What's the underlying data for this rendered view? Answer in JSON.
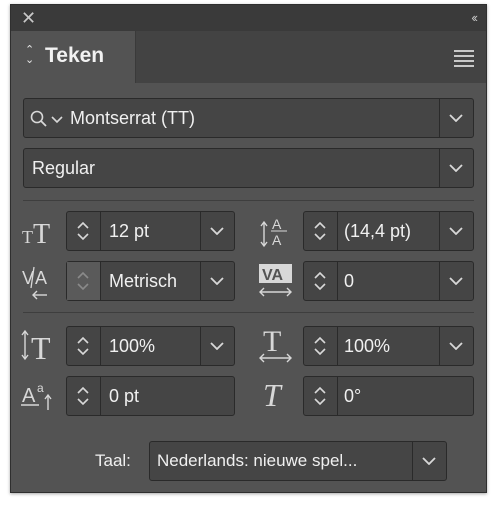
{
  "panel": {
    "close_icon": "close-icon",
    "collapse_glyph": "‹‹",
    "tab_label": "Teken",
    "menu_icon": "hamburger-menu-icon"
  },
  "font": {
    "family": "Montserrat (TT)",
    "style": "Regular"
  },
  "controls": {
    "font_size": "12 pt",
    "leading": "(14,4 pt)",
    "kerning": "Metrisch",
    "tracking": "0",
    "vertical_scale": "100%",
    "horizontal_scale": "100%",
    "baseline_shift": "0 pt",
    "skew": "0°"
  },
  "language": {
    "label": "Taal:",
    "value": "Nederlands: nieuwe spel..."
  },
  "colors": {
    "panel_bg": "#535353",
    "field_bg": "#454545",
    "titlebar_bg": "#3a3a3a"
  }
}
